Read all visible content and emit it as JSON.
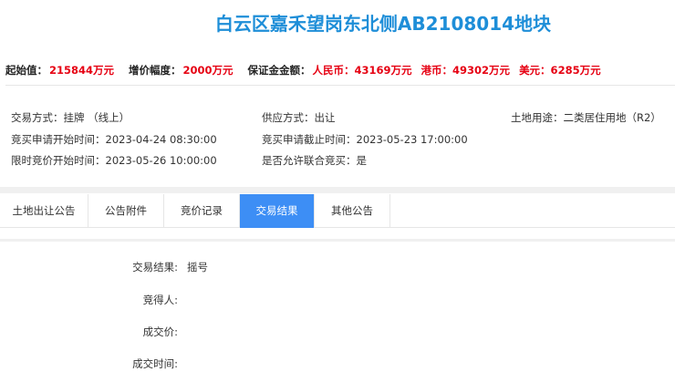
{
  "title": "白云区嘉禾望岗东北侧AB2108014地块",
  "prices": {
    "start_label": "起始值：",
    "start_value": "215844万元",
    "inc_label": "增价幅度：",
    "inc_value": "2000万元",
    "deposit_label": "保证金金额：",
    "rmb": "人民币：43169万元",
    "hkd": "港币：49302万元",
    "usd": "美元：6285万元"
  },
  "info": [
    {
      "label": "交易方式：",
      "value": "挂牌 （线上）"
    },
    {
      "label": "供应方式：",
      "value": "出让"
    },
    {
      "label": "土地用途：",
      "value": "二类居住用地（R2）"
    },
    {
      "label": "竞买申请开始时间：",
      "value": "2023-04-24 08:30:00"
    },
    {
      "label": "竞买申请截止时间：",
      "value": "2023-05-23 17:00:00"
    },
    {
      "label": "限时竞价开始时间：",
      "value": "2023-05-26 10:00:00"
    },
    {
      "label": "是否允许联合竞买：",
      "value": "是"
    }
  ],
  "tabs": [
    "土地出让公告",
    "公告附件",
    "竞价记录",
    "交易结果",
    "其他公告"
  ],
  "result": [
    {
      "label": "交易结果:",
      "value": "摇号"
    },
    {
      "label": "竞得人:",
      "value": ""
    },
    {
      "label": "成交价:",
      "value": ""
    },
    {
      "label": "成交时间:",
      "value": ""
    }
  ]
}
